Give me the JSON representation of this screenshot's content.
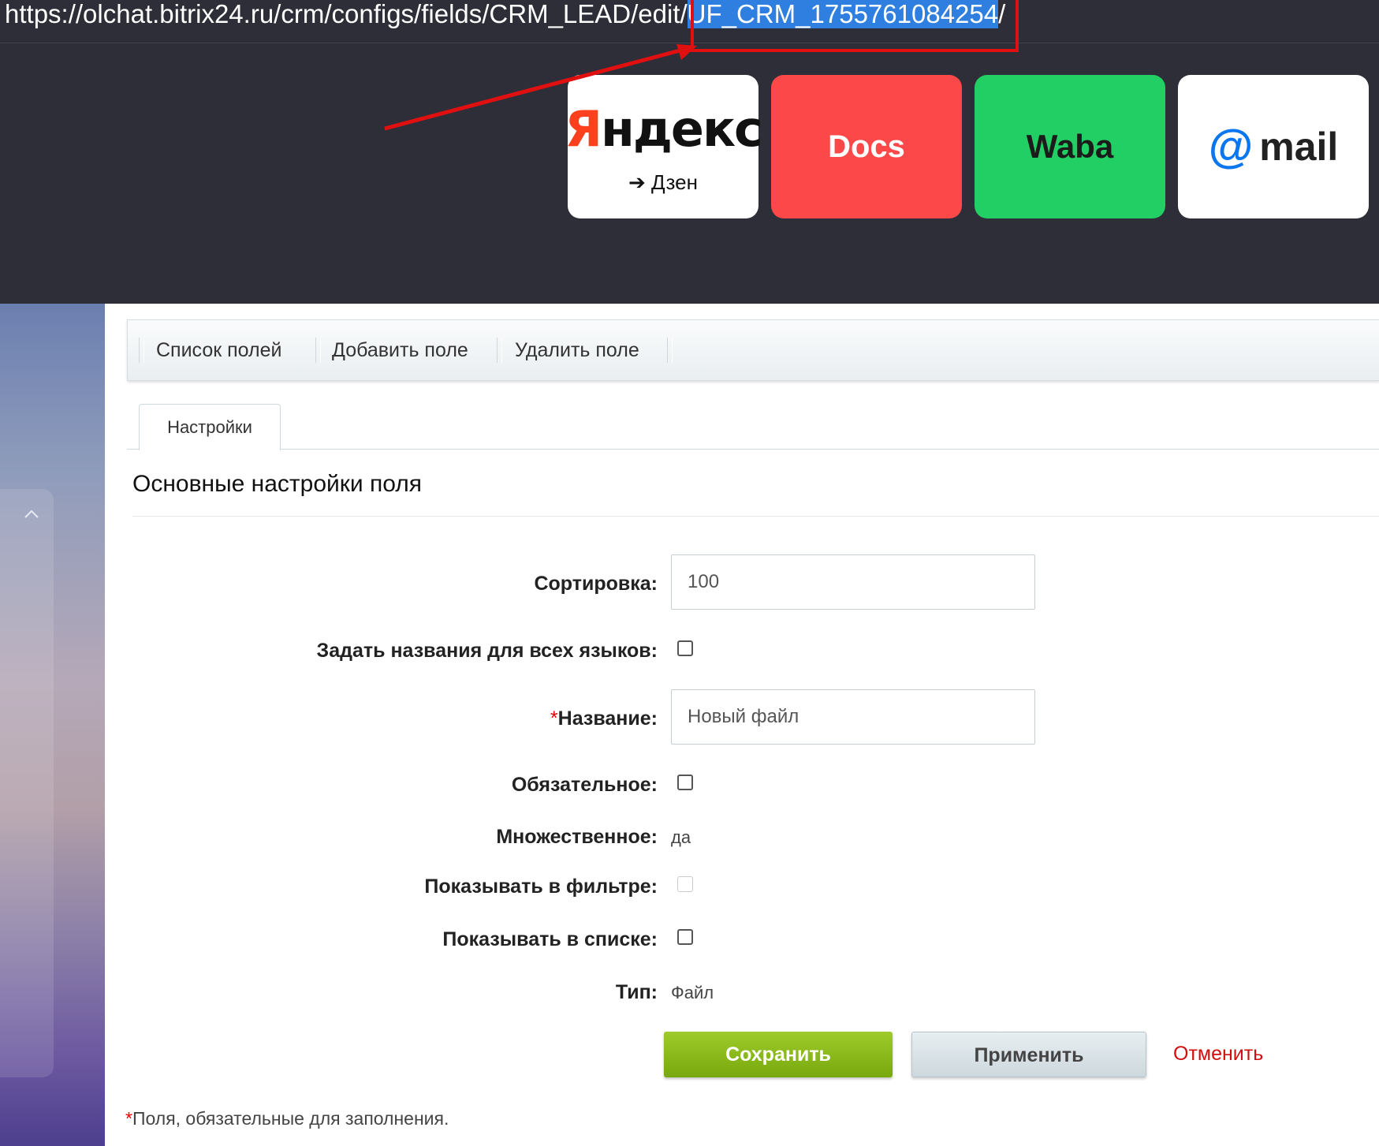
{
  "browser": {
    "url_prefix": "https://olchat.bitrix24.ru/crm/configs/fields/CRM_LEAD/edit/",
    "url_selected": "UF_CRM_1755761084254",
    "url_suffix": "/"
  },
  "speed_dial": [
    {
      "name": "Яндекс",
      "caption": "➔ Дзен"
    },
    {
      "name": "Docs"
    },
    {
      "name": "Waba"
    },
    {
      "name": "mail",
      "at_symbol": "@"
    }
  ],
  "toolbar": {
    "items": [
      "Список полей",
      "Добавить поле",
      "Удалить поле"
    ]
  },
  "tabs": [
    "Настройки"
  ],
  "section": {
    "title": "Основные настройки поля"
  },
  "form": {
    "sort": {
      "label": "Сортировка:",
      "value": "100"
    },
    "all_languages": {
      "label": "Задать названия для всех языков:",
      "checked": false
    },
    "name": {
      "required_mark": "*",
      "label": "Название:",
      "value": "Новый файл"
    },
    "mandatory": {
      "label": "Обязательное:",
      "checked": false
    },
    "multiple": {
      "label": "Множественное:",
      "value": "да"
    },
    "show_filter": {
      "label": "Показывать в фильтре:",
      "checked": false,
      "disabled": true
    },
    "show_list": {
      "label": "Показывать в списке:",
      "checked": false
    },
    "type": {
      "label": "Тип:",
      "value": "Файл"
    }
  },
  "buttons": {
    "save": "Сохранить",
    "apply": "Применить",
    "cancel": "Отменить"
  },
  "footnote": {
    "mark": "*",
    "text": "Поля, обязательные для заполнения."
  },
  "colors": {
    "browser_bg": "#2e2e38",
    "selection": "#2f7fe0",
    "annotation_red": "#e01010",
    "save_green": "#8bbd1c",
    "cancel_red": "#d20d0d",
    "docs_tile": "#fc4848",
    "waba_tile": "#22cf64",
    "mail_blue": "#0a76f0"
  }
}
